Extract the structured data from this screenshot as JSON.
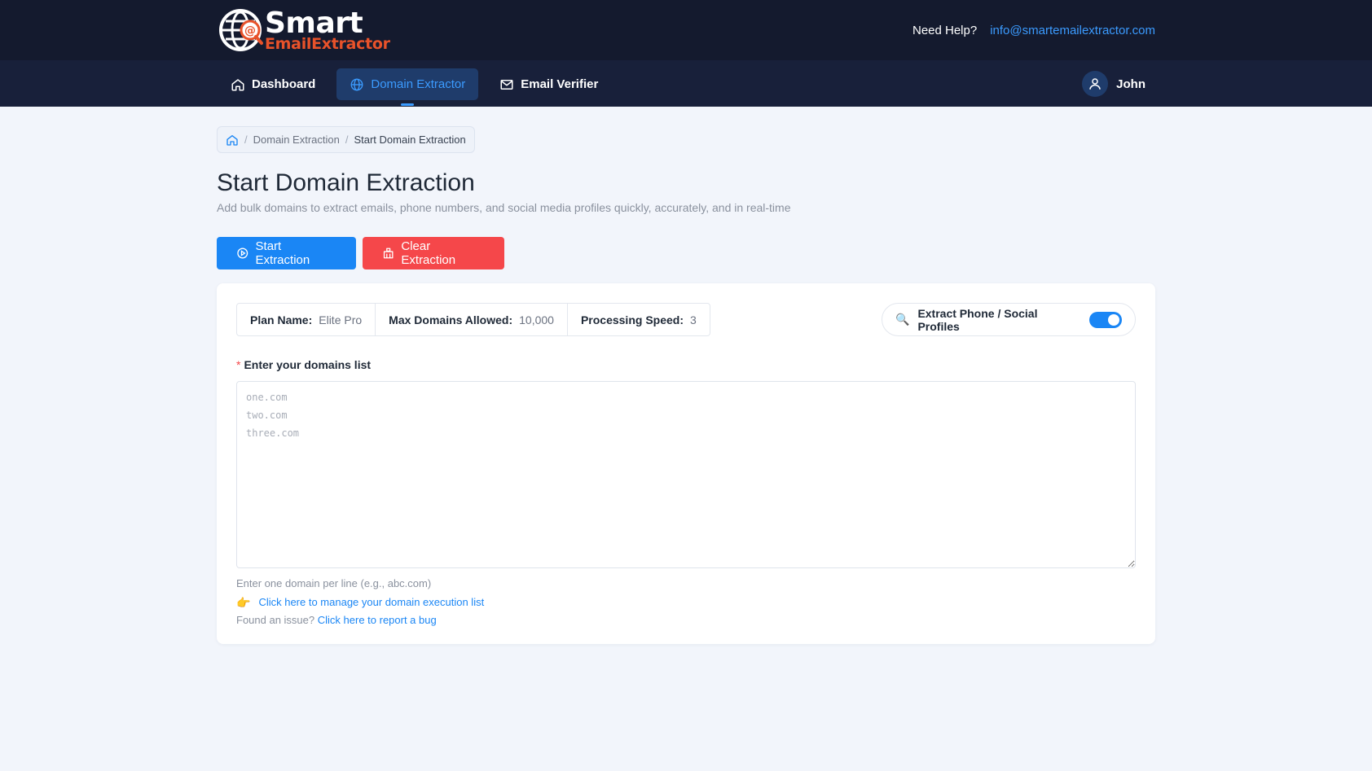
{
  "header": {
    "logo_title": "Smart",
    "logo_subtitle": "EmailExtractor",
    "help_label": "Need Help?",
    "help_email": "info@smartemailextractor.com"
  },
  "nav": {
    "items": [
      {
        "label": "Dashboard",
        "icon": "home-icon",
        "active": false
      },
      {
        "label": "Domain Extractor",
        "icon": "globe-icon",
        "active": true
      },
      {
        "label": "Email Verifier",
        "icon": "mail-icon",
        "active": false
      }
    ],
    "user_name": "John"
  },
  "breadcrumb": {
    "items": [
      "Domain Extraction",
      "Start Domain Extraction"
    ]
  },
  "page": {
    "title": "Start Domain Extraction",
    "subtitle": "Add bulk domains to extract emails, phone numbers, and social media profiles quickly, accurately, and in real-time"
  },
  "actions": {
    "start_label": "Start Extraction",
    "clear_label": "Clear Extraction"
  },
  "plan": {
    "plan_name_label": "Plan Name:",
    "plan_name_value": "Elite Pro",
    "max_domains_label": "Max Domains Allowed:",
    "max_domains_value": "10,000",
    "speed_label": "Processing Speed:",
    "speed_value": "3"
  },
  "toggle": {
    "label": "Extract Phone / Social Profiles",
    "enabled": true
  },
  "form": {
    "required_mark": "*",
    "label": "Enter your domains list",
    "placeholder": "one.com\ntwo.com\nthree.com",
    "value": "",
    "hint": "Enter one domain per line (e.g., abc.com)",
    "manage_emoji": "👉",
    "manage_link": "Click here to manage your domain execution list",
    "bug_prefix": "Found an issue?",
    "bug_link": "Click here to report a bug"
  },
  "colors": {
    "topbar": "#141a2e",
    "navbar": "#18203a",
    "accent": "#1a86f5",
    "danger": "#f5474a",
    "logo_orange": "#e8522a"
  }
}
